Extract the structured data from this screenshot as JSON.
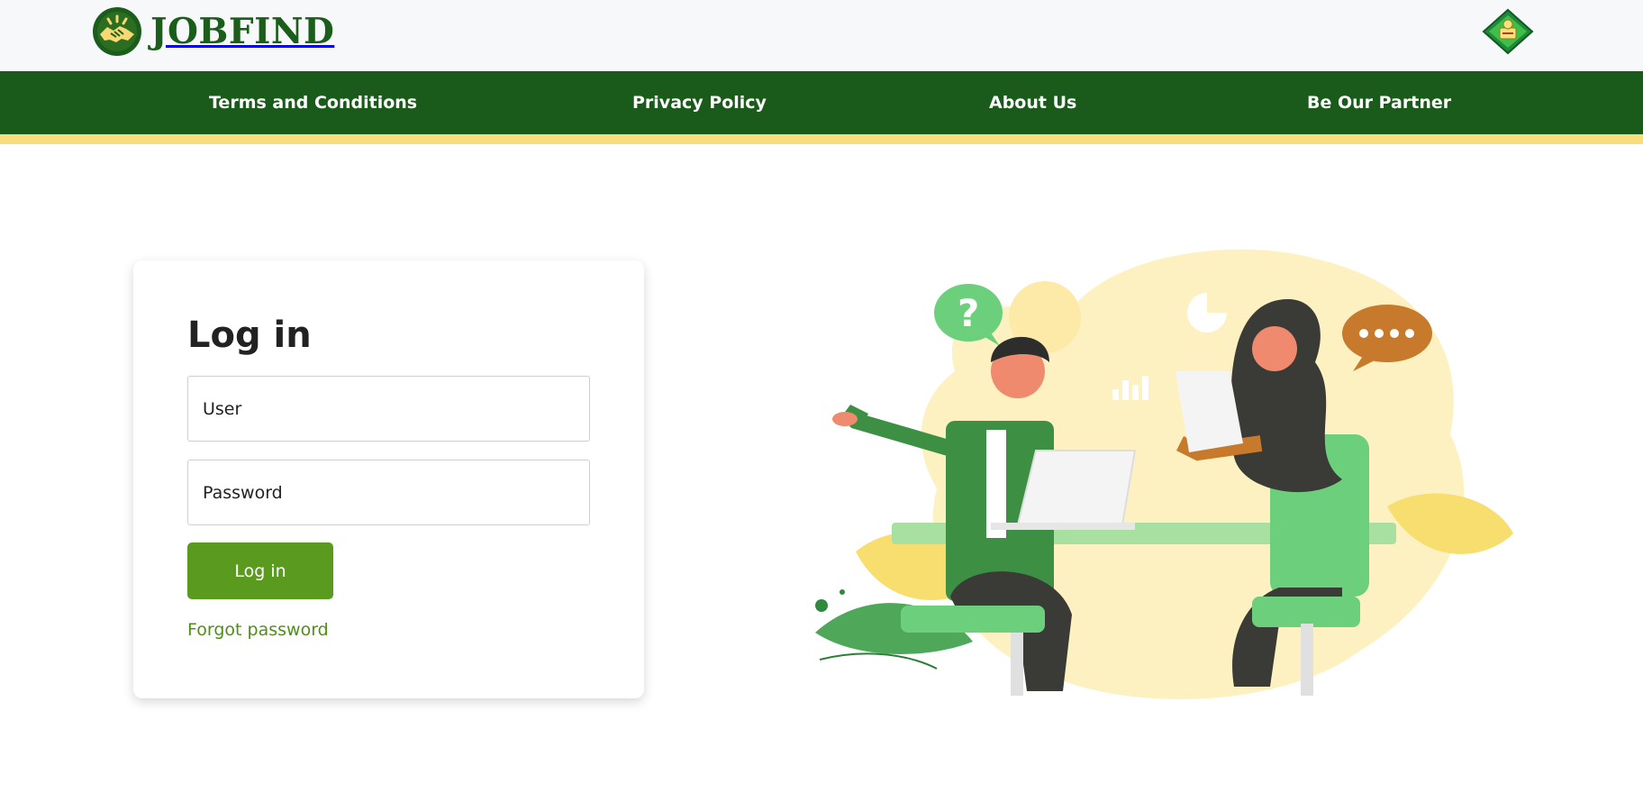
{
  "brand": {
    "name": "JOBFIND",
    "logo_icon": "handshake-icon",
    "emblem_icon": "government-emblem-icon"
  },
  "nav": {
    "items": [
      {
        "label": "Terms and Conditions"
      },
      {
        "label": "Privacy Policy"
      },
      {
        "label": "About Us"
      },
      {
        "label": "Be Our Partner"
      }
    ]
  },
  "login": {
    "title": "Log in",
    "user_placeholder": "User",
    "password_placeholder": "Password",
    "submit_label": "Log in",
    "forgot_label": "Forgot password"
  },
  "illustration": {
    "subject": "job-interview-illustration"
  },
  "colors": {
    "nav_bg": "#1a5a1a",
    "nav_stripe": "#f9dd7d",
    "brand_green": "#1b5e1c",
    "button_green": "#5a9a1e",
    "link_green": "#4f8f18",
    "topbar_bg": "#f7f8fa"
  }
}
